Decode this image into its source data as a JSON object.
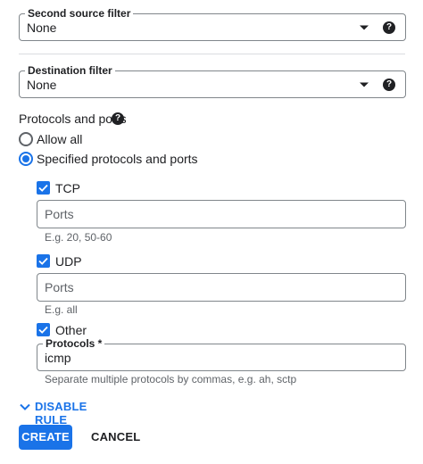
{
  "second_source_filter": {
    "label": "Second source filter",
    "value": "None",
    "help_glyph": "?"
  },
  "destination_filter": {
    "label": "Destination filter",
    "value": "None",
    "help_glyph": "?"
  },
  "protocols": {
    "heading": "Protocols and ports",
    "help_glyph": "?",
    "options": [
      {
        "label": "Allow all",
        "selected": false
      },
      {
        "label": "Specified protocols and ports",
        "selected": true
      }
    ],
    "tcp": {
      "label": "TCP",
      "checked": true,
      "ports_placeholder": "Ports",
      "hint": "E.g. 20, 50-60"
    },
    "udp": {
      "label": "UDP",
      "checked": true,
      "ports_placeholder": "Ports",
      "hint": "E.g. all"
    },
    "other": {
      "label": "Other",
      "checked": true,
      "field_label": "Protocols *",
      "value": "icmp",
      "hint": "Separate multiple protocols by commas, e.g. ah, sctp"
    }
  },
  "disable_rule": {
    "label": "DISABLE RULE",
    "icon": "chevron-down-icon"
  },
  "actions": {
    "create": "CREATE",
    "cancel": "CANCEL"
  },
  "colors": {
    "accent": "#1a73e8",
    "text": "#202124",
    "secondary_text": "#5f6368",
    "border": "#80868b"
  }
}
